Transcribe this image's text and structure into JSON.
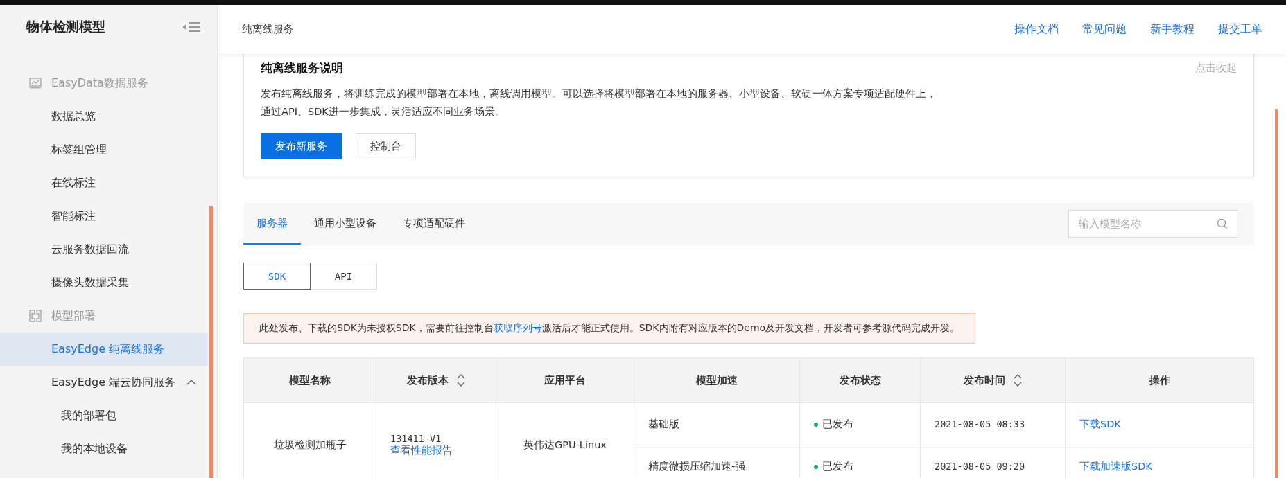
{
  "sidebar": {
    "title": "物体检测模型",
    "items": [
      {
        "label": "EasyData数据服务",
        "kind": "group"
      },
      {
        "label": "数据总览",
        "kind": "item",
        "selected": false
      },
      {
        "label": "标签组管理",
        "kind": "item",
        "selected": false
      },
      {
        "label": "在线标注",
        "kind": "item",
        "selected": false
      },
      {
        "label": "智能标注",
        "kind": "item",
        "selected": false
      },
      {
        "label": "云服务数据回流",
        "kind": "item",
        "selected": false
      },
      {
        "label": "摄像头数据采集",
        "kind": "item",
        "selected": false
      },
      {
        "label": "模型部署",
        "kind": "group"
      },
      {
        "label": "EasyEdge  纯离线服务",
        "kind": "item",
        "selected": true
      },
      {
        "label": "EasyEdge  端云协同服务",
        "kind": "item",
        "selected": false,
        "expanded": true
      },
      {
        "label": "我的部署包",
        "kind": "sub",
        "selected": false
      },
      {
        "label": "我的本地设备",
        "kind": "sub",
        "selected": false
      }
    ]
  },
  "header": {
    "title": "纯离线服务",
    "links": [
      "操作文档",
      "常见问题",
      "新手教程",
      "提交工单"
    ]
  },
  "intro": {
    "title": "纯离线服务说明",
    "collapse": "点击收起",
    "lines": [
      "发布纯离线服务，将训练完成的模型部署在本地，离线调用模型。可以选择将模型部署在本地的服务器、小型设备、软硬一体方案专项适配硬件上，",
      "通过API、SDK进一步集成，灵活适应不同业务场景。"
    ],
    "buttons": [
      {
        "label": "发布新服务",
        "kind": "primary"
      },
      {
        "label": "控制台",
        "kind": "default"
      }
    ]
  },
  "tabs": [
    {
      "label": "服务器",
      "selected": true
    },
    {
      "label": "通用小型设备",
      "selected": false
    },
    {
      "label": "专项适配硬件",
      "selected": false
    }
  ],
  "search": {
    "placeholder": "输入模型名称"
  },
  "toggle": [
    {
      "label": "SDK",
      "selected": true
    },
    {
      "label": "API",
      "selected": false
    }
  ],
  "notice": {
    "before": "此处发布、下载的SDK为未授权SDK，需要前往控制台",
    "link": "获取序列号",
    "after": "激活后才能正式使用。SDK内附有对应版本的Demo及开发文档，开发者可参考源代码完成开发。"
  },
  "table": {
    "columns": [
      {
        "label": "模型名称",
        "sortable": false
      },
      {
        "label": "发布版本",
        "sortable": true
      },
      {
        "label": "应用平台",
        "sortable": false
      },
      {
        "label": "模型加速",
        "sortable": false
      },
      {
        "label": "发布状态",
        "sortable": false
      },
      {
        "label": "发布时间",
        "sortable": true
      },
      {
        "label": "操作",
        "sortable": false
      }
    ],
    "rows": [
      {
        "name": "垃圾检测加瓶子",
        "version": "131411-V1",
        "report": "查看性能报告",
        "platform": "英伟达GPU-Linux",
        "subrows": [
          {
            "accel": "基础版",
            "status": "已发布",
            "color": "#1aaf5d",
            "time": "2021-08-05 08:33",
            "action": "下载SDK"
          },
          {
            "accel": "精度微损压缩加速-强",
            "status": "已发布",
            "color": "#1aaf5d",
            "time": "2021-08-05 09:20",
            "action": "下载加速版SDK"
          }
        ]
      }
    ]
  }
}
